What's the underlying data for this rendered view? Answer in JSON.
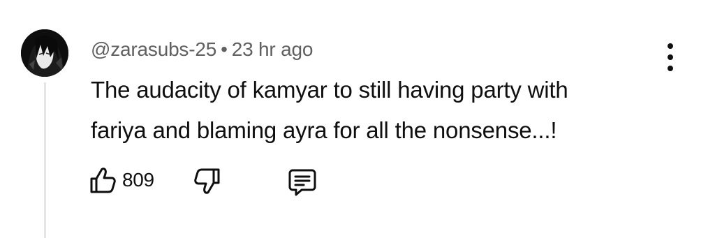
{
  "comment": {
    "author": "@zarasubs-25",
    "separator": "•",
    "time": "23 hr ago",
    "text_lines": [
      "The audacity of kamyar to still having party with",
      "fariya and blaming ayra for all the nonsense...!"
    ],
    "like_count": "809"
  },
  "icons": {
    "avatar": "avatar",
    "menu": "more-vert-icon",
    "like": "thumbs-up-icon",
    "dislike": "thumbs-down-icon",
    "reply": "comment-reply-icon"
  },
  "colors": {
    "text": "#0f0f0f",
    "meta": "#606060",
    "thread_line": "#e5e5e5",
    "background": "#ffffff"
  }
}
